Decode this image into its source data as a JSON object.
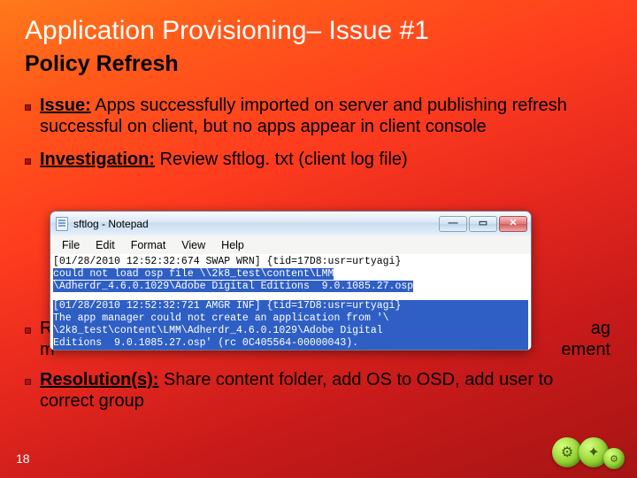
{
  "title": "Application Provisioning– Issue #1",
  "subtitle": "Policy Refresh",
  "bullets": {
    "issue": {
      "label": "Issue:",
      "text": " Apps successfully imported on server and publishing refresh successful on client, but no apps appear in client console"
    },
    "investigation": {
      "label": "Investigation:",
      "text": " Review sftlog. txt (client log file)"
    },
    "rootcause": {
      "label": "R",
      "suffix1": "ag",
      "suffix2": "ement",
      "line2_pre": "m"
    },
    "resolution": {
      "label": "Resolution(s):",
      "text": " Share content folder, add OS to OSD, add user to correct group"
    }
  },
  "notepad": {
    "window_title": "sftlog - Notepad",
    "menus": [
      "File",
      "Edit",
      "Format",
      "View",
      "Help"
    ],
    "buttons": {
      "min": "—",
      "max": "▭",
      "close": "✕"
    },
    "lines": [
      {
        "plain": "[01/28/2010 12:52:32:674 SWAP WRN] {tid=17D8:usr=urtyagi}"
      },
      {
        "sel": "could not load osp file \\\\2k8_test\\content\\LMM"
      },
      {
        "sel": "\\Adherdr_4.6.0.1029\\Adobe Digital Editions  9.0.1085.27.osp"
      },
      {
        "gap": true
      },
      {
        "sel": "[01/28/2010 12:52:32:721 AMGR INF] {tid=17D8:usr=urtyagi}"
      },
      {
        "sel": "The app manager could not create an application from '\\"
      },
      {
        "sel": "\\2k8_test\\content\\LMM\\Adherdr_4.6.0.1029\\Adobe Digital"
      },
      {
        "sel": "Editions  9.0.1085.27.osp' (rc 0C405564-00000043)."
      }
    ]
  },
  "page_number": "18",
  "corner_icons": [
    "gear",
    "bulb",
    "gears"
  ]
}
